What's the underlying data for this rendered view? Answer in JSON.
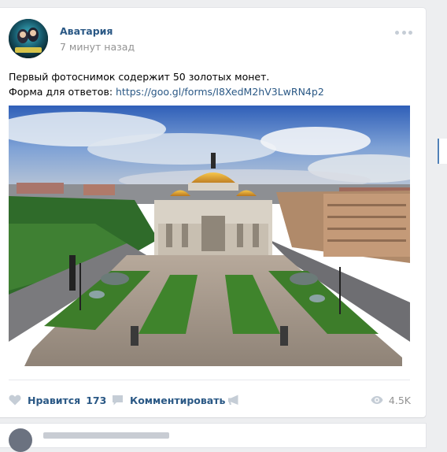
{
  "post": {
    "author": "Аватария",
    "time": "7 минут назад",
    "text_line1": "Первый фотоснимок содержит 50 золотых монет.",
    "text_line2_prefix": "Форма для ответов: ",
    "link": "https://goo.gl/forms/I8XedM2hV3LwRN4p2"
  },
  "actions": {
    "like_label": "Нравится",
    "like_count": "173",
    "comment_label": "Комментировать",
    "views": "4.5K"
  },
  "icons": {
    "like": "heart-icon",
    "comment": "comment-icon",
    "share": "megaphone-icon",
    "views": "eye-icon",
    "more": "more-dots-icon"
  },
  "colors": {
    "link": "#2a5885",
    "muted": "#939393",
    "icon": "#c5cdd6",
    "background": "#edeef0"
  }
}
